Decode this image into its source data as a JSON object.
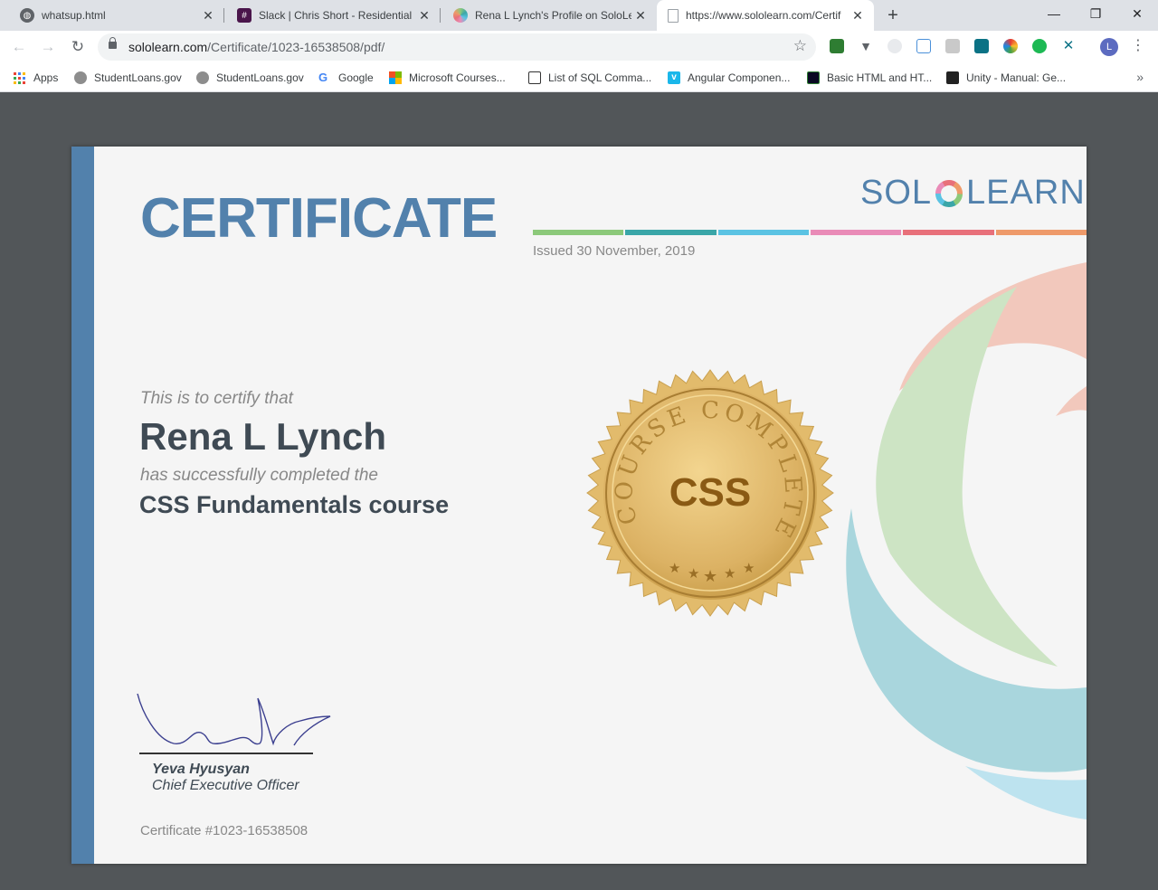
{
  "browser": {
    "tabs": [
      {
        "title": "whatsup.html",
        "icon": "globe-icon"
      },
      {
        "title": "Slack | Chris Short - Residential G",
        "icon": "slack-icon"
      },
      {
        "title": "Rena L Lynch's Profile on SoloLea",
        "icon": "sololearn-icon"
      },
      {
        "title": "https://www.sololearn.com/Certif",
        "icon": "document-icon"
      }
    ],
    "new_tab": "+",
    "window_controls": {
      "minimize": "—",
      "restore": "❐",
      "close": "✕"
    },
    "address": {
      "domain": "sololearn.com",
      "path": "/Certificate/1023-16538508/pdf/"
    },
    "profile_initial": "L",
    "bookmarks": [
      {
        "label": "Apps"
      },
      {
        "label": "StudentLoans.gov"
      },
      {
        "label": "StudentLoans.gov"
      },
      {
        "label": "Google"
      },
      {
        "label": "Microsoft Courses..."
      },
      {
        "label": "List of SQL Comma..."
      },
      {
        "label": "Angular Componen..."
      },
      {
        "label": "Basic HTML and HT..."
      },
      {
        "label": "Unity - Manual: Ge..."
      }
    ],
    "bookmarks_more": "»"
  },
  "certificate": {
    "title": "CERTIFICATE",
    "logo_left": "SOL",
    "logo_right": "LEARN",
    "issued": "Issued 30 November, 2019",
    "certify_text": "This is to certify that",
    "recipient": "Rena L Lynch",
    "completed_text": "has successfully completed the",
    "course": "CSS Fundamentals course",
    "seal_label": "CSS",
    "seal_arc_left": "COURSE",
    "seal_arc_right": "COMPLETED",
    "signer_name": "Yeva Hyusyan",
    "signer_title": "Chief Executive Officer",
    "certificate_number": "Certificate #1023-16538508"
  },
  "colors": {
    "accent_blue": "#5281ac",
    "stripes": [
      "#8cc97a",
      "#3aa6a8",
      "#5bc3e3",
      "#e98bb7",
      "#e8707a",
      "#ee9a6a"
    ],
    "seal_gold": "#d7ad5a",
    "chrome_tab_bg": "#dee1e6"
  }
}
